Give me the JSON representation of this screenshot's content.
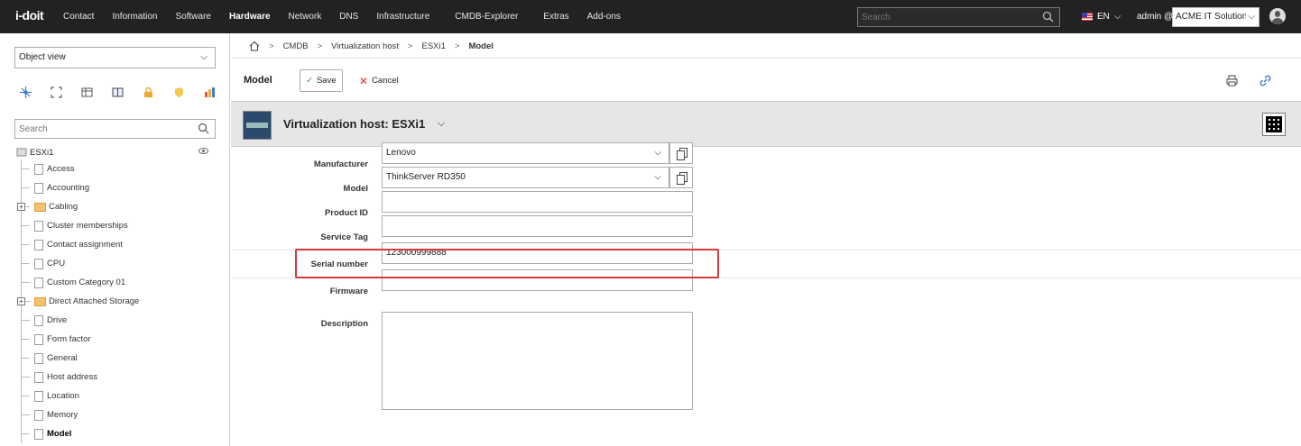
{
  "app": {
    "logo": "i-doit"
  },
  "nav": [
    "Contact",
    "Information",
    "Software",
    "Hardware",
    "Network",
    "DNS",
    "Infrastructure",
    "CMDB-Explorer",
    "Extras",
    "Add-ons"
  ],
  "top": {
    "search_placeholder": "Search",
    "lang": "EN",
    "user": "admin @",
    "tenant": "ACME IT Solutions"
  },
  "sidebar": {
    "view_select": "Object view",
    "search_placeholder": "Search",
    "root": "ESXi1",
    "items": [
      {
        "label": "Access",
        "type": "doc"
      },
      {
        "label": "Accounting",
        "type": "doc"
      },
      {
        "label": "Cabling",
        "type": "folder"
      },
      {
        "label": "Cluster memberships",
        "type": "doc"
      },
      {
        "label": "Contact assignment",
        "type": "doc"
      },
      {
        "label": "CPU",
        "type": "doc"
      },
      {
        "label": "Custom Category 01",
        "type": "doc"
      },
      {
        "label": "Direct Attached Storage",
        "type": "folder"
      },
      {
        "label": "Drive",
        "type": "doc"
      },
      {
        "label": "Form factor",
        "type": "doc"
      },
      {
        "label": "General",
        "type": "doc"
      },
      {
        "label": "Host address",
        "type": "doc"
      },
      {
        "label": "Location",
        "type": "doc"
      },
      {
        "label": "Memory",
        "type": "doc"
      },
      {
        "label": "Model",
        "type": "doc"
      }
    ]
  },
  "breadcrumb": [
    "CMDB",
    "Virtualization host",
    "ESXi1",
    "Model"
  ],
  "toolbar": {
    "title": "Model",
    "save": "Save",
    "cancel": "Cancel"
  },
  "object": {
    "title": "Virtualization host: ESXi1"
  },
  "form": {
    "manufacturer": {
      "label": "Manufacturer",
      "value": "Lenovo"
    },
    "model": {
      "label": "Model",
      "value": "ThinkServer RD350"
    },
    "product_id": {
      "label": "Product ID",
      "value": ""
    },
    "service_tag": {
      "label": "Service Tag",
      "value": ""
    },
    "serial": {
      "label": "Serial number",
      "value": "123000999888"
    },
    "firmware": {
      "label": "Firmware",
      "value": ""
    },
    "description": {
      "label": "Description",
      "value": ""
    }
  },
  "colors": {
    "topbar": "#222222",
    "highlight": "#d63a3a",
    "accent": "#2e6fd1"
  }
}
